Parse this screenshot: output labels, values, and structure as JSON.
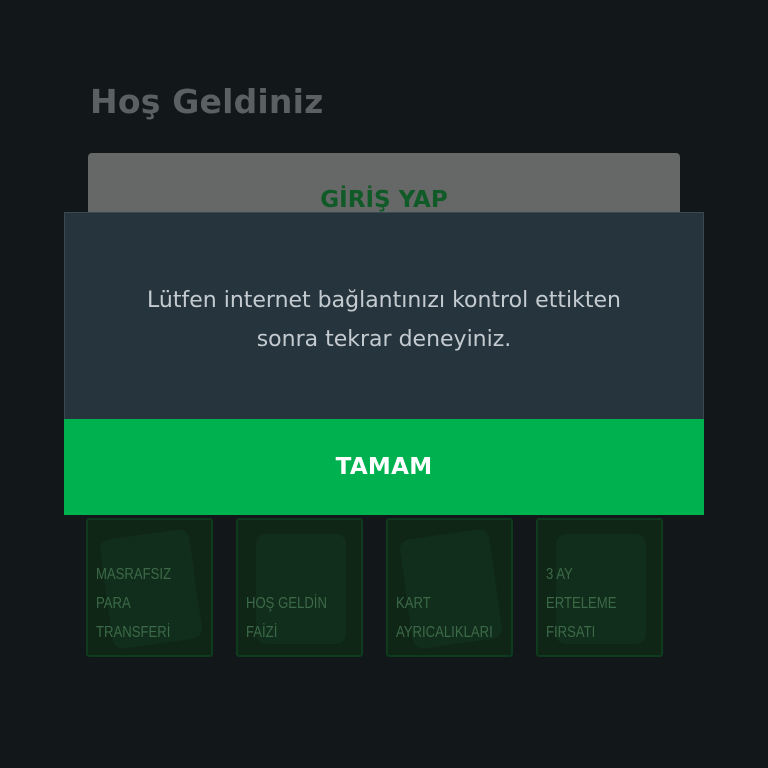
{
  "welcome": {
    "title": "Hoş Geldiniz",
    "login_label": "GİRİŞ YAP"
  },
  "promos": [
    {
      "label": "MASRAFSIZ\nPARA\nTRANSFERİ",
      "icon": "phone-icon"
    },
    {
      "label": "HOŞ GELDİN\nFAİZİ",
      "icon": "marifetli-badge-icon"
    },
    {
      "label": "KART\nAYRICALIKLARI",
      "icon": "cards-icon"
    },
    {
      "label": "3 AY\nERTELEME\nFIRSATI",
      "icon": "3-ay-badge-icon"
    }
  ],
  "dialog": {
    "message": "Lütfen internet bağlantınızı kontrol ettikten sonra tekrar deneyiniz.",
    "ok_label": "TAMAM"
  },
  "colors": {
    "accent": "#00b24f",
    "dialog_bg": "#26343d",
    "background": "#121719"
  }
}
